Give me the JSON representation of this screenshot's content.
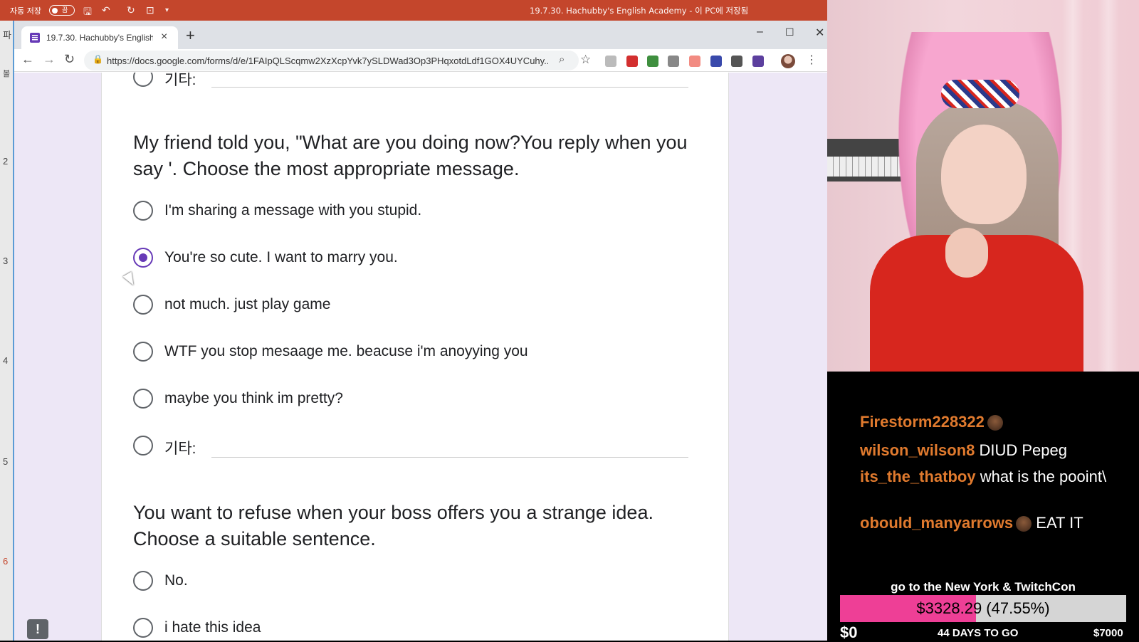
{
  "office_bar": {
    "autosave_label": "자동 저장",
    "autosave_state": "끔",
    "document_title": "19.7.30. Hachubby's English Academy - 이 PC에 저장됨",
    "accent": "#c4462c"
  },
  "word_side": {
    "left_marks": [
      "파",
      "볼"
    ],
    "ruler_numbers": [
      "2",
      "3",
      "4",
      "5",
      "6"
    ]
  },
  "browser": {
    "tab_title": "19.7.30. Hachubby's English Academy",
    "url": "https://docs.google.com/forms/d/e/1FAIpQLScqmw2XzXcpYvk7ySLDWad3Op3PHqxotdLdf1GOX4UYCuhy...",
    "icons": [
      "back-icon",
      "forward-icon",
      "reload-icon",
      "lock-icon",
      "zoom-icon",
      "star-icon"
    ]
  },
  "form": {
    "top_other_label": "기타:",
    "question1": {
      "text": "My friend told you, \"What are you doing now?You reply when you say '. Choose the most appropriate message.",
      "options": [
        {
          "label": "I'm sharing a message with you stupid.",
          "checked": false
        },
        {
          "label": "You're so cute. I want to marry you.",
          "checked": true
        },
        {
          "label": "not much. just play game",
          "checked": false
        },
        {
          "label": "WTF you stop mesaage me. beacuse i'm anoyying you",
          "checked": false
        },
        {
          "label": "maybe you think im pretty?",
          "checked": false
        }
      ],
      "other_label": "기타:"
    },
    "question2": {
      "text": "You want to refuse when your boss offers you a strange idea. Choose a suitable sentence.",
      "options": [
        {
          "label": "No.",
          "checked": false
        },
        {
          "label": "i hate this idea",
          "checked": false
        }
      ]
    },
    "feedback_icon": "!",
    "accent": "#673ab7"
  },
  "stream": {
    "chat": [
      {
        "user": "Firestorm228322",
        "message": "",
        "emote": true
      },
      {
        "user": "wilson_wilson8",
        "message": "DIUD Pepeg",
        "emote": false
      },
      {
        "user": "its_the_thatboy",
        "message": "what is the pooint\\",
        "emote": false
      },
      {
        "user": "obould_manyarrows",
        "message": "EAT IT",
        "emote": true
      }
    ],
    "user_color": "#e07a2e",
    "goal": {
      "title": "go to the New York & TwitchCon",
      "amount": "$3328.29 (47.55%)",
      "progress": 0.4755,
      "min": "$0",
      "days_left": "44 DAYS TO GO",
      "max": "$7000",
      "fill_color": "#ee3f96"
    }
  }
}
